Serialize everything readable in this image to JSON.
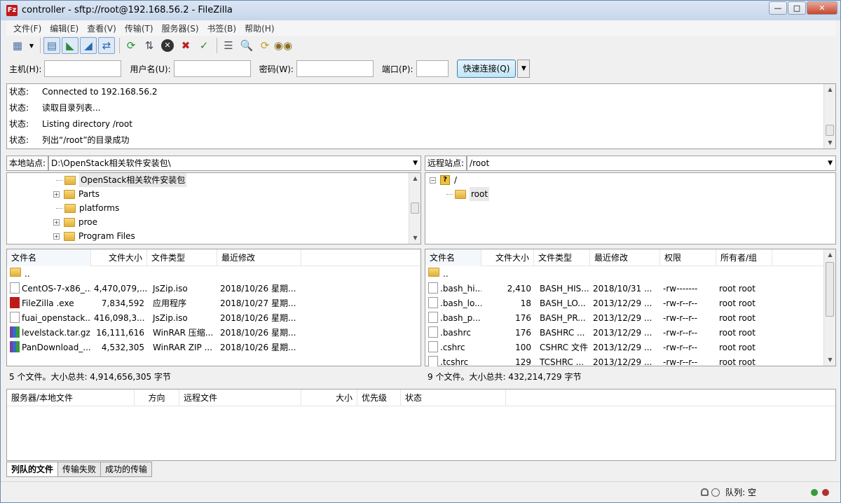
{
  "window": {
    "title": "controller - sftp://root@192.168.56.2 - FileZilla",
    "app_icon_text": "Fz"
  },
  "menu": [
    "文件(F)",
    "编辑(E)",
    "查看(V)",
    "传输(T)",
    "服务器(S)",
    "书签(B)",
    "帮助(H)"
  ],
  "quickconnect": {
    "host_label": "主机(H):",
    "user_label": "用户名(U):",
    "pass_label": "密码(W):",
    "port_label": "端口(P):",
    "host_value": "",
    "user_value": "",
    "pass_value": "",
    "port_value": "",
    "button_label": "快速连接(Q)"
  },
  "log": [
    {
      "label": "状态:",
      "text": "Connected to 192.168.56.2"
    },
    {
      "label": "状态:",
      "text": "读取目录列表..."
    },
    {
      "label": "状态:",
      "text": "Listing directory /root"
    },
    {
      "label": "状态:",
      "text": "列出“/root”的目录成功"
    }
  ],
  "local": {
    "site_label": "本地站点:",
    "path": "D:\\OpenStack相关软件安装包\\",
    "tree": [
      {
        "name": "OpenStack相关软件安装包",
        "expander": ""
      },
      {
        "name": "Parts",
        "expander": "+"
      },
      {
        "name": "platforms",
        "expander": ""
      },
      {
        "name": "proe",
        "expander": "+"
      },
      {
        "name": "Program Files",
        "expander": "+"
      }
    ],
    "columns": [
      "文件名",
      "文件大小",
      "文件类型",
      "最近修改"
    ],
    "files": [
      {
        "name": "..",
        "size": "",
        "type": "",
        "modified": "",
        "icon": "folder"
      },
      {
        "name": "CentOS-7-x86_...",
        "size": "4,470,079,...",
        "type": "JsZip.iso",
        "modified": "2018/10/26 星期...",
        "icon": "doc"
      },
      {
        "name": "FileZilla .exe",
        "size": "7,834,592",
        "type": "应用程序",
        "modified": "2018/10/27 星期...",
        "icon": "fz"
      },
      {
        "name": "fuai_openstack...",
        "size": "416,098,3...",
        "type": "JsZip.iso",
        "modified": "2018/10/26 星期...",
        "icon": "doc"
      },
      {
        "name": "levelstack.tar.gz",
        "size": "16,111,616",
        "type": "WinRAR 压缩...",
        "modified": "2018/10/26 星期...",
        "icon": "rar"
      },
      {
        "name": "PanDownload_...",
        "size": "4,532,305",
        "type": "WinRAR ZIP ...",
        "modified": "2018/10/26 星期...",
        "icon": "rar"
      }
    ],
    "summary": "5 个文件。大小总共: 4,914,656,305 字节"
  },
  "remote": {
    "site_label": "远程站点:",
    "path": "/root",
    "tree": [
      {
        "name": "/",
        "expander": "−"
      },
      {
        "name": "root",
        "expander": ""
      }
    ],
    "columns": [
      "文件名",
      "文件大小",
      "文件类型",
      "最近修改",
      "权限",
      "所有者/组"
    ],
    "files": [
      {
        "name": "..",
        "size": "",
        "type": "",
        "modified": "",
        "perm": "",
        "owner": "",
        "icon": "folder"
      },
      {
        "name": ".bash_hi...",
        "size": "2,410",
        "type": "BASH_HIS...",
        "modified": "2018/10/31 ...",
        "perm": "-rw-------",
        "owner": "root root",
        "icon": "doc"
      },
      {
        "name": ".bash_lo...",
        "size": "18",
        "type": "BASH_LO...",
        "modified": "2013/12/29 ...",
        "perm": "-rw-r--r--",
        "owner": "root root",
        "icon": "doc"
      },
      {
        "name": ".bash_p...",
        "size": "176",
        "type": "BASH_PR...",
        "modified": "2013/12/29 ...",
        "perm": "-rw-r--r--",
        "owner": "root root",
        "icon": "doc"
      },
      {
        "name": ".bashrc",
        "size": "176",
        "type": "BASHRC ...",
        "modified": "2013/12/29 ...",
        "perm": "-rw-r--r--",
        "owner": "root root",
        "icon": "doc"
      },
      {
        "name": ".cshrc",
        "size": "100",
        "type": "CSHRC 文件",
        "modified": "2013/12/29 ...",
        "perm": "-rw-r--r--",
        "owner": "root root",
        "icon": "doc"
      },
      {
        "name": ".tcshrc",
        "size": "129",
        "type": "TCSHRC ...",
        "modified": "2013/12/29 ...",
        "perm": "-rw-r--r--",
        "owner": "root root",
        "icon": "doc"
      }
    ],
    "summary": "9 个文件。大小总共: 432,214,729 字节"
  },
  "queue": {
    "columns": [
      "服务器/本地文件",
      "方向",
      "远程文件",
      "大小",
      "优先级",
      "状态"
    ],
    "tabs": [
      "列队的文件",
      "传输失败",
      "成功的传输"
    ]
  },
  "statusbar": {
    "queue_text": "队列: 空"
  },
  "colors": {
    "accent": "#3c7fb1",
    "folder": "#e2b03a",
    "filezilla_red": "#bf1a1a"
  }
}
